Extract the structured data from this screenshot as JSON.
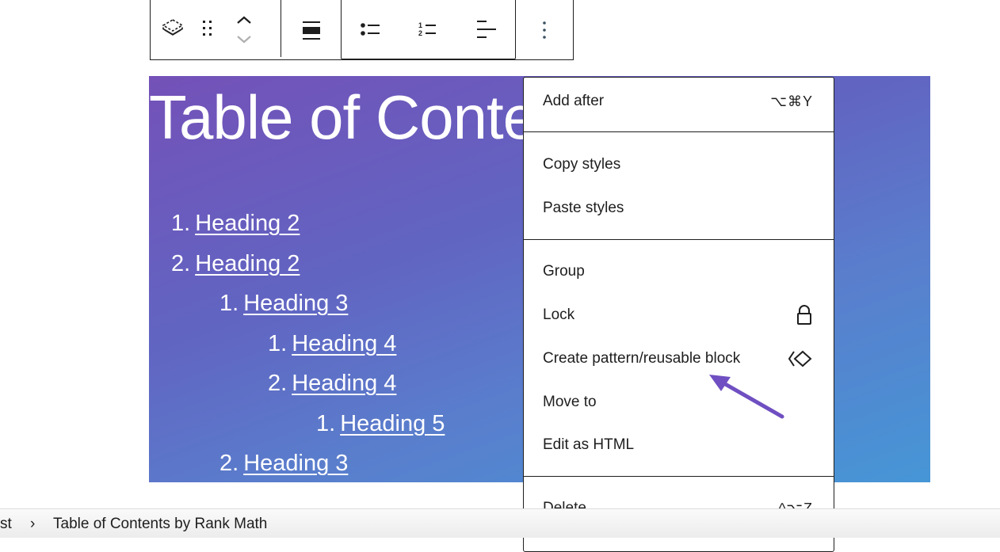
{
  "toolbar": {
    "buttons": [
      {
        "name": "block-type",
        "icon": "layers-icon"
      },
      {
        "name": "drag",
        "icon": "drag-handle-icon"
      },
      {
        "name": "move-up",
        "icon": "chevron-up-icon"
      },
      {
        "name": "move-down",
        "icon": "chevron-down-icon"
      },
      {
        "name": "align",
        "icon": "align-wide-icon"
      },
      {
        "name": "unordered-list",
        "icon": "list-bullets-icon"
      },
      {
        "name": "ordered-list",
        "icon": "list-numbered-icon"
      },
      {
        "name": "outdent",
        "icon": "list-indent-icon"
      },
      {
        "name": "options",
        "icon": "kebab-menu-icon"
      }
    ]
  },
  "toc": {
    "title": "Table of Contents",
    "items": [
      {
        "num": "1.",
        "label": "Heading 2",
        "level": 0
      },
      {
        "num": "2.",
        "label": "Heading 2",
        "level": 0
      },
      {
        "num": "1.",
        "label": "Heading 3",
        "level": 1
      },
      {
        "num": "1.",
        "label": "Heading 4",
        "level": 2
      },
      {
        "num": "2.",
        "label": "Heading 4",
        "level": 2
      },
      {
        "num": "1.",
        "label": "Heading 5",
        "level": 3
      },
      {
        "num": "2.",
        "label": "Heading 3",
        "level": 1
      }
    ],
    "gradient_start": "#7451b8",
    "gradient_end": "#4696d6"
  },
  "menu": {
    "add_after": {
      "label": "Add after",
      "shortcut": "⌥⌘Y"
    },
    "copy_styles": {
      "label": "Copy styles"
    },
    "paste_styles": {
      "label": "Paste styles"
    },
    "group": {
      "label": "Group"
    },
    "lock": {
      "label": "Lock",
      "icon": "lock-icon"
    },
    "create_pattern": {
      "label": "Create pattern/reusable block",
      "icon": "reusable-block-icon"
    },
    "move_to": {
      "label": "Move to"
    },
    "edit_html": {
      "label": "Edit as HTML"
    },
    "delete": {
      "label": "Delete",
      "shortcut": "^⌥Z"
    }
  },
  "annotation": {
    "color": "#6f4fc1",
    "icon": "arrow-pointer-icon"
  },
  "footer": {
    "crumb_prev": "st",
    "separator": "›",
    "crumb_current": "Table of Contents by Rank Math"
  }
}
